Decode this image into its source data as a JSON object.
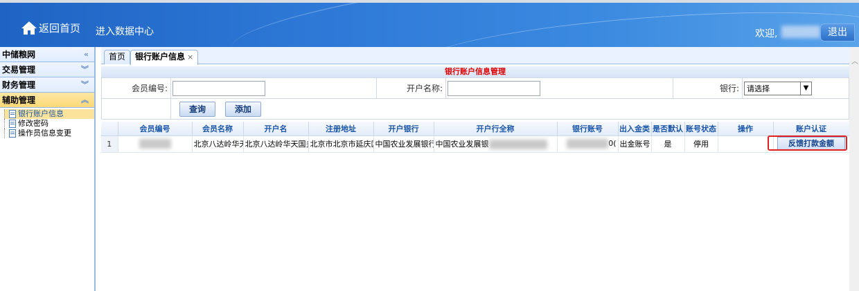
{
  "header": {
    "home_label": "返回首页",
    "data_center_label": "进入数据中心",
    "welcome_label": "欢迎,",
    "logout_label": "退出"
  },
  "sidebar": {
    "items": [
      {
        "label": "中储粮网",
        "chev": "«"
      },
      {
        "label": "交易管理",
        "chev": "»"
      },
      {
        "label": "财务管理",
        "chev": "»"
      },
      {
        "label": "辅助管理",
        "chev": "«"
      }
    ],
    "tree": [
      {
        "label": "银行账户信息"
      },
      {
        "label": "修改密码"
      },
      {
        "label": "操作员信息变更"
      }
    ]
  },
  "tabs": {
    "home": "首页",
    "active": "银行账户信息",
    "close": "×"
  },
  "page_title": "银行账户信息管理",
  "form": {
    "member_no_label": "会员编号:",
    "account_name_label": "开户名称:",
    "bank_label": "银行:",
    "bank_select_value": "请选择",
    "query_button": "查询",
    "add_button": "添加"
  },
  "grid": {
    "columns": [
      "会员编号",
      "会员名称",
      "开户名",
      "注册地址",
      "开户银行",
      "开户行全称",
      "银行账号",
      "出入金类",
      "是否默认",
      "账号状态",
      "操作",
      "账户认证"
    ],
    "rows": [
      {
        "num": "1",
        "member_name": "北京八达岭华天",
        "account_name": "北京八达岭华天国多",
        "address": "北京市北京市延庆区",
        "bank": "中国农业发展银行",
        "bank_full": "中国农业发展银",
        "account_no_suffix": "0(",
        "type": "出金账号",
        "is_default": "是",
        "status": "停用",
        "action_label": "反馈打款金额"
      }
    ]
  }
}
